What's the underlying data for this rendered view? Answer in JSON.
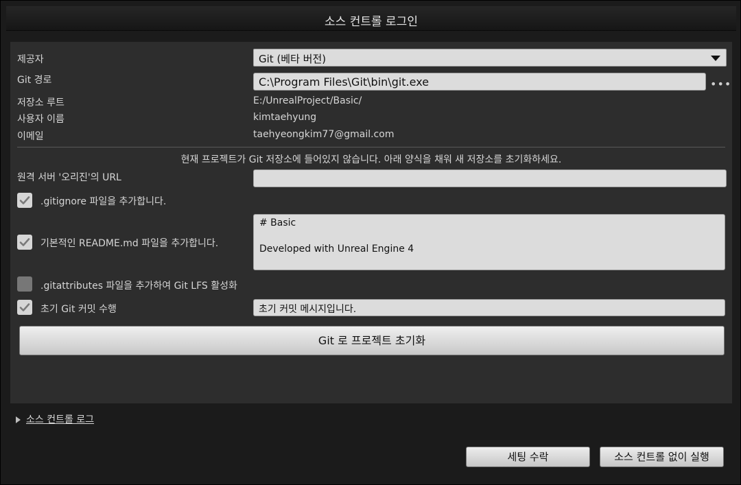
{
  "window": {
    "title": "소스 컨트롤 로그인"
  },
  "form": {
    "provider_label": "제공자",
    "provider_value": "Git (베타 버전)",
    "git_path_label": "Git 경로",
    "git_path_value": "C:\\Program Files\\Git\\bin\\git.exe",
    "browse_label": "•••",
    "repo_root_label": "저장소 루트",
    "repo_root_value": "E:/UnrealProject/Basic/",
    "user_name_label": "사용자 이름",
    "user_name_value": "kimtaehyung",
    "email_label": "이메일",
    "email_value": "taehyeongkim77@gmail.com",
    "notice": "현재 프로젝트가 Git 저장소에 들어있지 않습니다. 아래 양식을 채워 새 저장소를 초기화하세요.",
    "remote_url_label": "원격 서버 '오리진'의 URL",
    "remote_url_value": "",
    "gitignore_label": ".gitignore 파일을 추가합니다.",
    "gitignore_checked": true,
    "readme_label": "기본적인 README.md 파일을 추가합니다.",
    "readme_checked": true,
    "readme_line1": "# Basic",
    "readme_line2": "Developed with Unreal Engine 4",
    "gitattributes_label": ".gitattributes 파일을 추가하여 Git LFS 활성화",
    "gitattributes_checked": false,
    "initial_commit_label": "초기 Git 커밋 수행",
    "initial_commit_checked": true,
    "commit_message_value": "초기 커밋 메시지입니다.",
    "init_button": "Git 로 프로젝트 초기화"
  },
  "log": {
    "label": "소스 컨트롤 로그"
  },
  "footer": {
    "accept_button": "세팅 수락",
    "no_sc_button": "소스 컨트롤 없이 실행"
  },
  "colors": {
    "panel": "#2d2d2d",
    "field": "#dcdcdc",
    "text": "#d6d6d6"
  }
}
